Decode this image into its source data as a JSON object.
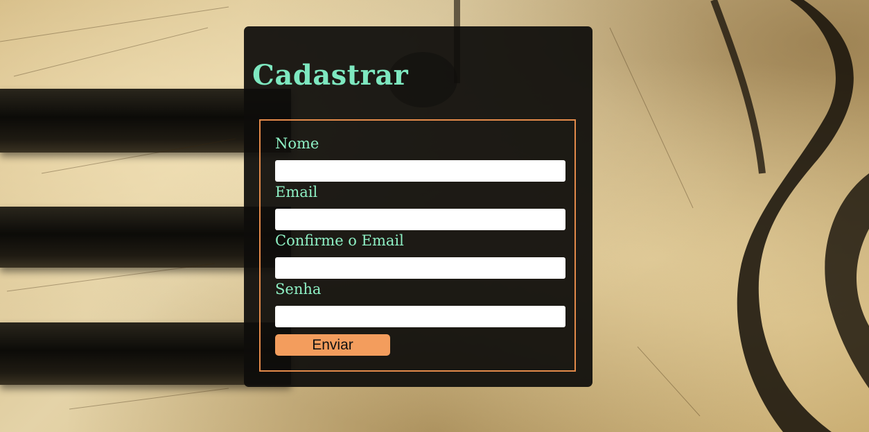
{
  "form": {
    "title": "Cadastrar",
    "fields": [
      {
        "label": "Nome",
        "value": ""
      },
      {
        "label": "Email",
        "value": ""
      },
      {
        "label": "Confirme o Email",
        "value": ""
      },
      {
        "label": "Senha",
        "value": ""
      }
    ],
    "submit_label": "Enviar"
  },
  "colors": {
    "title": "#7ee8c0",
    "label": "#8ef0c4",
    "form_border": "#e38a4a",
    "button": "#f39d5d",
    "panel": "#0e0d0b"
  }
}
